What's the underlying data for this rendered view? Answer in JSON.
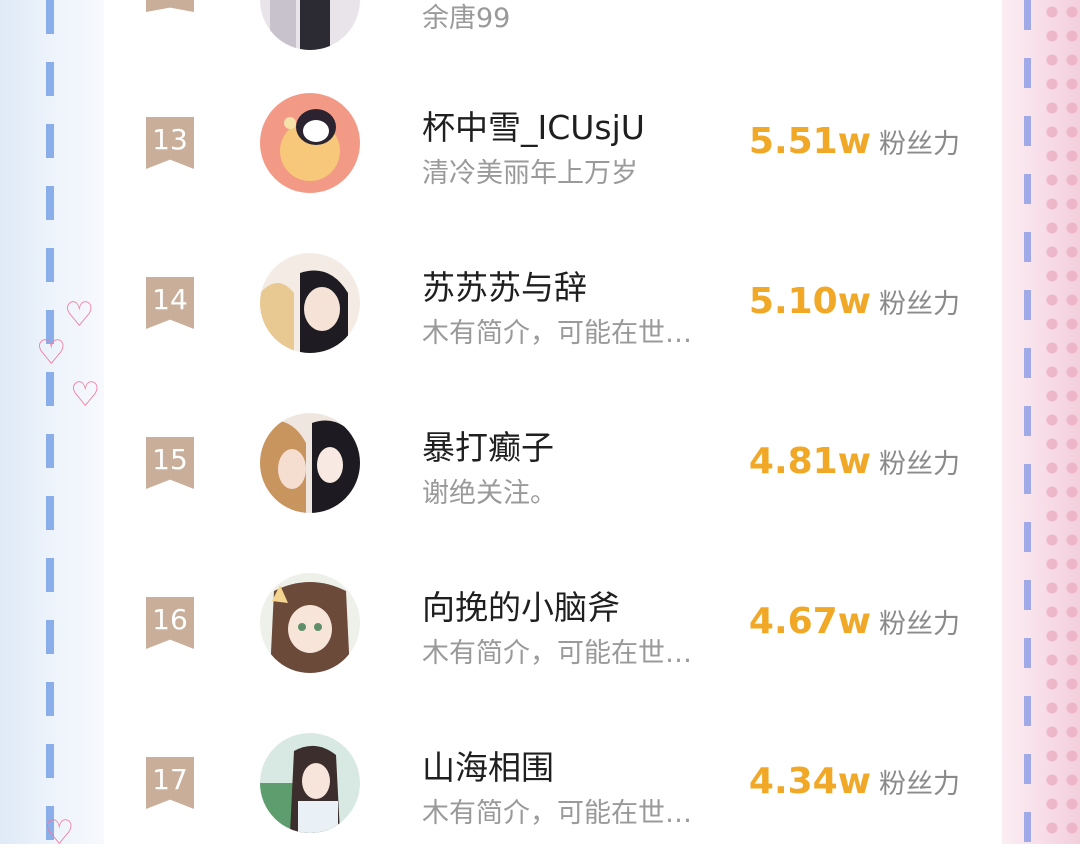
{
  "list": {
    "partial_top": {
      "bio": "余唐99"
    },
    "rows": [
      {
        "rank": "13",
        "name": "杯中雪_ICUsjU",
        "bio": "清冷美丽年上万岁",
        "score": "5.51w",
        "unit": "粉丝力"
      },
      {
        "rank": "14",
        "name": "苏苏苏与辞",
        "bio": "木有简介，可能在世…",
        "score": "5.10w",
        "unit": "粉丝力"
      },
      {
        "rank": "15",
        "name": "暴打癫子",
        "bio": "谢绝关注。",
        "score": "4.81w",
        "unit": "粉丝力"
      },
      {
        "rank": "16",
        "name": "向挽的小脑斧",
        "bio": "木有简介，可能在世…",
        "score": "4.67w",
        "unit": "粉丝力"
      },
      {
        "rank": "17",
        "name": "山海相围",
        "bio": "木有简介，可能在世…",
        "score": "4.34w",
        "unit": "粉丝力"
      }
    ]
  },
  "colors": {
    "rank_badge": "#c9ae99",
    "score": "#f0a826",
    "name": "#1f1f1f",
    "bio": "#9a9a9a"
  },
  "icons": {
    "rank_badge": "ribbon-badge-icon",
    "heart": "heart-outline-icon"
  }
}
